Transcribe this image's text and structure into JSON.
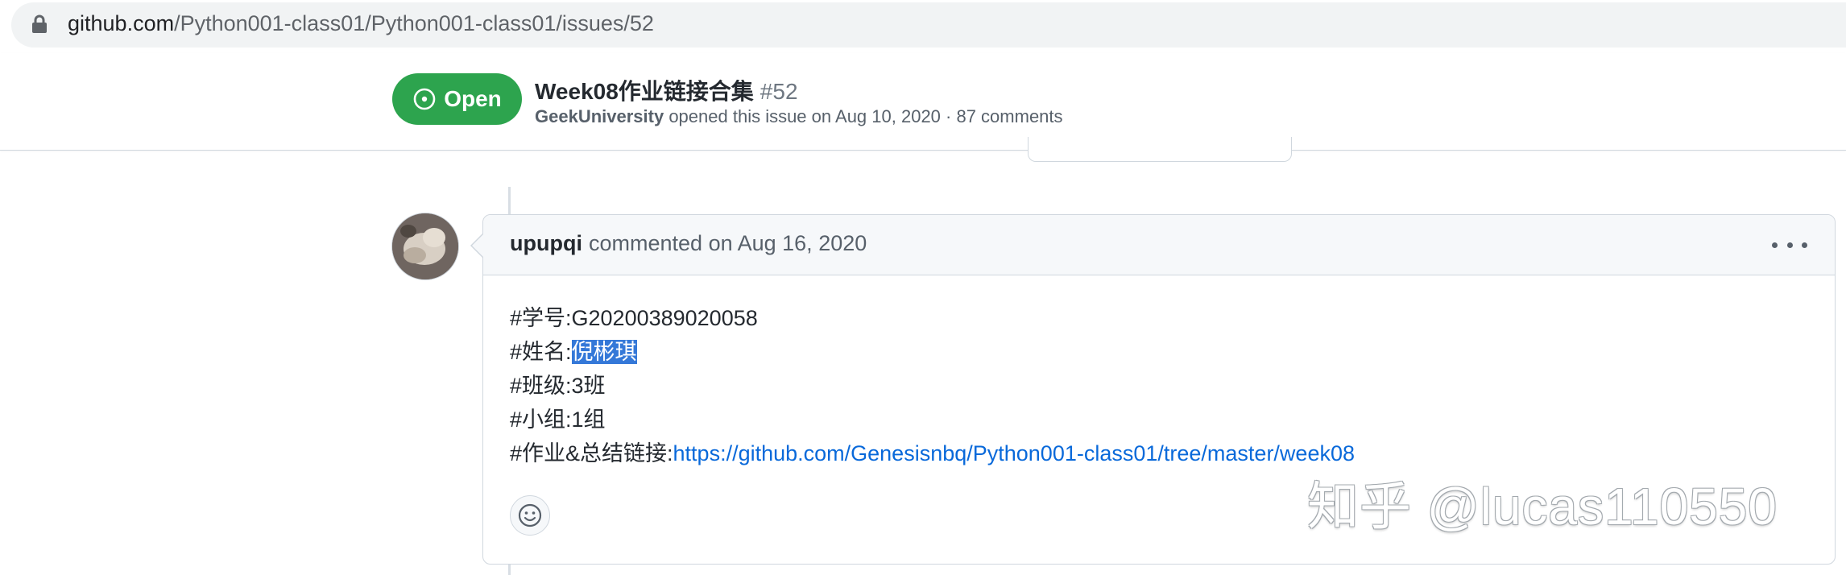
{
  "browser": {
    "url_host": "github.com",
    "url_path": "/Python001-class01/Python001-class01/issues/52"
  },
  "issue": {
    "state_label": "Open",
    "title": "Week08作业链接合集",
    "number": "#52",
    "author": "GeekUniversity",
    "meta_text": " opened this issue on Aug 10, 2020 · 87 comments"
  },
  "comment": {
    "author": "upupqi",
    "date_text": "commented on Aug 16, 2020",
    "lines": {
      "student_id": "#学号:G20200389020058",
      "name_label": "#姓名:",
      "name_value": "倪彬琪",
      "class": "#班级:3班",
      "group": "#小组:1组",
      "link_label": "#作业&总结链接:",
      "link_url": "https://github.com/Genesisnbq/Python001-class01/tree/master/week08"
    }
  },
  "watermark": "知乎 @lucas110550",
  "icons": {
    "lock": "lock-icon",
    "open_state": "issue-opened-icon",
    "kebab": "kebab-horizontal-icon",
    "emoji": "smiley-icon"
  },
  "colors": {
    "open_green": "#2da44e",
    "link_blue": "#0969da",
    "selection_blue": "#3478d8"
  }
}
